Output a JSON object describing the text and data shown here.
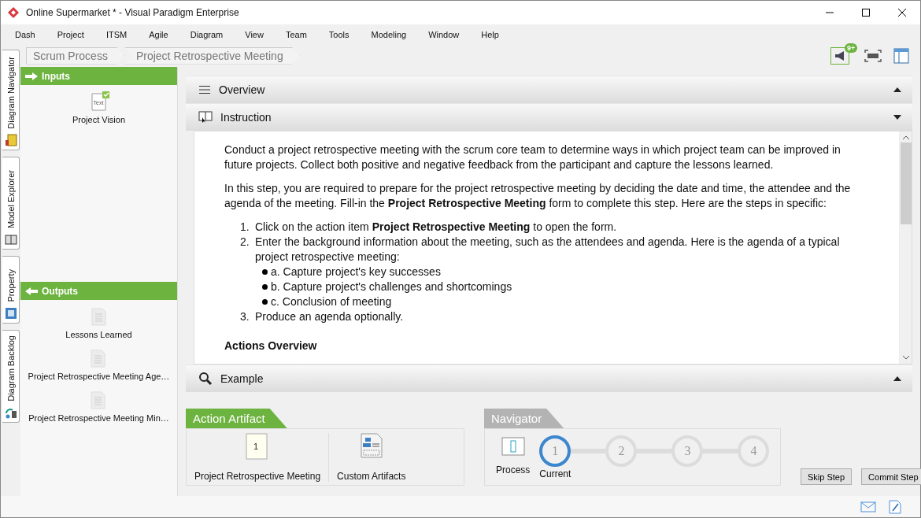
{
  "window": {
    "title": "Online Supermarket * - Visual Paradigm Enterprise"
  },
  "menu": [
    "Dash",
    "Project",
    "ITSM",
    "Agile",
    "Diagram",
    "View",
    "Team",
    "Tools",
    "Modeling",
    "Window",
    "Help"
  ],
  "breadcrumb": [
    "Scrum Process",
    "Project Retrospective Meeting"
  ],
  "toolbar": {
    "notification_badge": "9+"
  },
  "side_tabs": [
    {
      "label": "Diagram Navigator",
      "kind": "navigator"
    },
    {
      "label": "Model Explorer",
      "kind": "explorer"
    },
    {
      "label": "Property",
      "kind": "property"
    },
    {
      "label": "Diagram Backlog",
      "kind": "backlog"
    }
  ],
  "inputs": {
    "title": "Inputs",
    "items": [
      {
        "label": "Project Vision",
        "kind": "text",
        "icon_text": "Text",
        "done": true
      }
    ]
  },
  "outputs": {
    "title": "Outputs",
    "items": [
      {
        "label": "Lessons Learned",
        "kind": "doc"
      },
      {
        "label": "Project Retrospective Meeting Age…",
        "kind": "doc"
      },
      {
        "label": "Project Retrospective Meeting Min…",
        "kind": "doc"
      }
    ]
  },
  "sections": [
    {
      "title": "Overview",
      "kind": "overview",
      "expanded": false
    },
    {
      "title": "Instruction",
      "kind": "instruction",
      "expanded": true
    },
    {
      "title": "Example",
      "kind": "example",
      "expanded": false
    }
  ],
  "instruction": {
    "paragraphs": [
      "Conduct a project retrospective meeting with the scrum core team to determine ways in which project team can be improved in future projects. Collect both positive and negative feedback from the participant and capture the lessons learned.",
      "In this step, you are required to prepare for the project retrospective meeting by deciding the date and time, the attendee and the agenda of the meeting. Fill-in the **Project Retrospective Meeting** form to complete this step. Here are the steps in specific:"
    ],
    "steps": [
      {
        "number": "1.",
        "text": "Click on the action item **Project Retrospective Meeting** to open the form."
      },
      {
        "number": "2.",
        "text": "Enter the background information about the meeting, such as the attendees and agenda. Here is the agenda of a typical project retrospective meeting:",
        "bullets": [
          "a. Capture project's key successes",
          "b. Capture project's challenges and shortcomings",
          "c. Conclusion of meeting"
        ]
      },
      {
        "number": "3.",
        "text": "Produce an agenda optionally."
      }
    ],
    "heading": "Actions Overview"
  },
  "action_artifact": {
    "title": "Action Artifact",
    "items": [
      {
        "label": "Project Retrospective Meeting",
        "kind": "form",
        "icon_text": "1"
      },
      {
        "label": "Custom Artifacts",
        "kind": "custom"
      }
    ]
  },
  "navigator": {
    "title": "Navigator",
    "process_label": "Process",
    "steps": [
      {
        "number": "1",
        "label": "Current",
        "selected": true
      },
      {
        "number": "2",
        "selected": false
      },
      {
        "number": "3",
        "selected": false
      },
      {
        "number": "4",
        "selected": false
      }
    ]
  },
  "buttons": [
    "Skip Step",
    "Commit Step"
  ]
}
